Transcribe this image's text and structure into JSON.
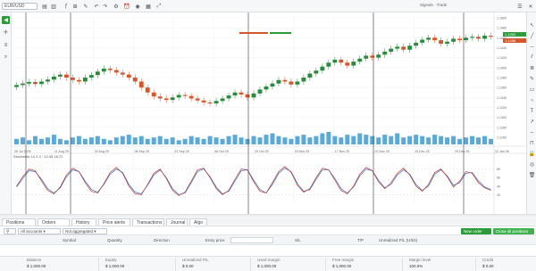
{
  "toolbar": {
    "symbol": "EUR/USD",
    "status_text": "Signals · Trade",
    "icons": [
      "chart-type-icon",
      "candles-icon",
      "indicators-icon",
      "compare-icon",
      "draw-icon",
      "undo-icon",
      "redo-icon",
      "settings-icon",
      "alert-icon",
      "snapshot-icon",
      "layout-icon",
      "fullscreen-icon"
    ]
  },
  "chart": {
    "last_price_tag": "1.1462",
    "bid_tag": "1.1458",
    "ask_tag": "1.1460",
    "date_labels": [
      "28 Jul 2025",
      "11 Aug 25",
      "25 Aug 25",
      "08 Sep 25",
      "22 Sep 25",
      "06 Oct 25",
      "20 Oct 25",
      "03 Nov 25",
      "17 Nov 25",
      "01 Dec 25",
      "15 Dec 25",
      "29 Dec 25",
      "12 Jan 26"
    ],
    "price_labels": [
      "1.1500",
      "1.1480",
      "1.1460",
      "1.1440",
      "1.1420",
      "1.1400",
      "1.1380",
      "1.1360",
      "1.1340",
      "1.1320",
      "1.1300",
      "1.1280",
      "1.1260"
    ],
    "osc_labels": [
      "80",
      "60",
      "40",
      "20"
    ],
    "indicator_legend": "Stochastic 14 3 3 · 22.45 18.72"
  },
  "chart_data": {
    "type": "candlestick",
    "closes": [
      1.1365,
      1.1368,
      1.1371,
      1.1367,
      1.1372,
      1.1376,
      1.1382,
      1.1386,
      1.138,
      1.1375,
      1.1372,
      1.138,
      1.1385,
      1.1392,
      1.1398,
      1.1395,
      1.139,
      1.1386,
      1.138,
      1.1372,
      1.136,
      1.135,
      1.1342,
      1.1338,
      1.1335,
      1.134,
      1.1345,
      1.1343,
      1.1338,
      1.1334,
      1.133,
      1.1328,
      1.1333,
      1.1338,
      1.1344,
      1.135,
      1.1346,
      1.134,
      1.1348,
      1.1356,
      1.1362,
      1.1368,
      1.1375,
      1.1372,
      1.1366,
      1.1372,
      1.138,
      1.1388,
      1.1394,
      1.1402,
      1.141,
      1.1416,
      1.141,
      1.1404,
      1.1412,
      1.1418,
      1.1424,
      1.142,
      1.1426,
      1.1432,
      1.1438,
      1.1442,
      1.1436,
      1.1444,
      1.145,
      1.1456,
      1.146,
      1.1455,
      1.1448,
      1.1452,
      1.1458,
      1.1455,
      1.146,
      1.1462,
      1.1458,
      1.1464,
      1.1462
    ],
    "volume": [
      4,
      5,
      3,
      6,
      4,
      5,
      7,
      4,
      3,
      5,
      6,
      4,
      5,
      6,
      4,
      3,
      5,
      6,
      7,
      5,
      6,
      4,
      5,
      6,
      4,
      5,
      3,
      4,
      6,
      5,
      4,
      6,
      5,
      4,
      6,
      7,
      5,
      4,
      6,
      5,
      7,
      8,
      6,
      5,
      4,
      6,
      7,
      5,
      6,
      8,
      9,
      6,
      5,
      7,
      6,
      8,
      7,
      6,
      5,
      7,
      6,
      8,
      5,
      6,
      7,
      6,
      5,
      7,
      6,
      5,
      6,
      4,
      5,
      6,
      5,
      6,
      4
    ],
    "stoch_k": [
      40,
      62,
      80,
      76,
      52,
      30,
      22,
      38,
      66,
      82,
      74,
      48,
      28,
      24,
      46,
      72,
      84,
      70,
      40,
      22,
      20,
      44,
      70,
      80,
      58,
      30,
      18,
      26,
      52,
      78,
      82,
      60,
      34,
      20,
      30,
      56,
      80,
      78,
      50,
      28,
      24,
      48,
      74,
      86,
      72,
      42,
      26,
      34,
      60,
      82,
      78,
      54,
      30,
      22,
      40,
      68,
      84,
      76,
      50,
      34,
      48,
      70,
      82,
      66,
      40,
      28,
      44,
      72,
      80,
      62,
      38,
      52,
      74,
      70,
      48,
      36,
      30
    ],
    "stoch_d": [
      38,
      58,
      76,
      74,
      56,
      34,
      24,
      36,
      62,
      78,
      74,
      52,
      32,
      26,
      44,
      68,
      80,
      72,
      44,
      26,
      22,
      42,
      66,
      78,
      60,
      34,
      20,
      24,
      48,
      74,
      80,
      62,
      38,
      22,
      28,
      52,
      76,
      78,
      54,
      32,
      24,
      44,
      70,
      82,
      74,
      46,
      28,
      32,
      56,
      78,
      78,
      58,
      34,
      24,
      38,
      64,
      80,
      76,
      54,
      36,
      44,
      66,
      78,
      68,
      44,
      30,
      40,
      68,
      78,
      64,
      42,
      48,
      70,
      72,
      52,
      38,
      32
    ],
    "osc_ylim": [
      0,
      100
    ]
  },
  "tabs": [
    {
      "label": "Positions",
      "count": ""
    },
    {
      "label": "Orders",
      "count": ""
    },
    {
      "label": "History",
      "count": ""
    },
    {
      "label": "Price alerts",
      "count": ""
    },
    {
      "label": "Transactions",
      "count": ""
    },
    {
      "label": "Journal",
      "count": ""
    },
    {
      "label": "Algo",
      "count": ""
    }
  ],
  "toolbar2": {
    "account_select": "All accounts",
    "group_select": "Not aggregated",
    "new_order": "New order",
    "close_all": "Close all positions"
  },
  "columns": [
    "Symbol",
    "Quantity",
    "Direction",
    "Entry price",
    "S/L",
    "T/P",
    "Unrealized P/L (USD)"
  ],
  "summary": [
    {
      "label": "Balance",
      "value": "$ 1,000.00"
    },
    {
      "label": "Equity",
      "value": "$ 1,000.00"
    },
    {
      "label": "Unrealized P/L",
      "value": "$ 0.00"
    },
    {
      "label": "Used margin",
      "value": "$ 1,000.00"
    },
    {
      "label": "Free margin",
      "value": "$ 1,000.00"
    },
    {
      "label": "Margin level",
      "value": "100.0%"
    },
    {
      "label": "Credit",
      "value": "$ 0.00"
    }
  ],
  "colors": {
    "up": "#2a8a3e",
    "down": "#d2572b",
    "vol": "#5aa9d6",
    "k_line": "#c0392b",
    "d_line": "#2e6fd1",
    "green": "#2e9b3a"
  }
}
